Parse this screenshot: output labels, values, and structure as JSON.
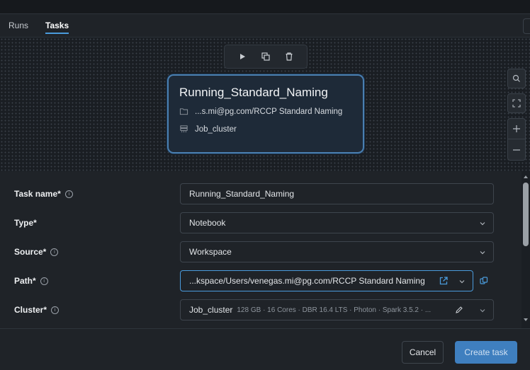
{
  "tabs": [
    {
      "label": "Runs",
      "active": false
    },
    {
      "label": "Tasks",
      "active": true
    }
  ],
  "canvas": {
    "toolbar_icons": [
      "play-icon",
      "copy-icon",
      "trash-icon"
    ],
    "node": {
      "title": "Running_Standard_Naming",
      "path": "...s.mi@pg.com/RCCP Standard Naming",
      "cluster": "Job_cluster"
    },
    "side_controls": [
      "search-icon",
      "fit-view-icon",
      "zoom-in-icon",
      "zoom-out-icon"
    ]
  },
  "form": {
    "task_name": {
      "label": "Task name*",
      "value": "Running_Standard_Naming"
    },
    "type": {
      "label": "Type*",
      "value": "Notebook"
    },
    "source": {
      "label": "Source*",
      "value": "Workspace"
    },
    "path": {
      "label": "Path*",
      "value": "...kspace/Users/venegas.mi@pg.com/RCCP Standard Naming"
    },
    "cluster": {
      "label": "Cluster*",
      "value": "Job_cluster",
      "meta": "128 GB · 16 Cores · DBR 16.4 LTS · Photon · Spark 3.5.2 · ..."
    }
  },
  "footer": {
    "cancel_label": "Cancel",
    "create_label": "Create task"
  },
  "colors": {
    "accent": "#4a9bdc",
    "primary_button": "#3f7fbf",
    "node_border": "#4a7fb0",
    "background": "#1f2328"
  }
}
